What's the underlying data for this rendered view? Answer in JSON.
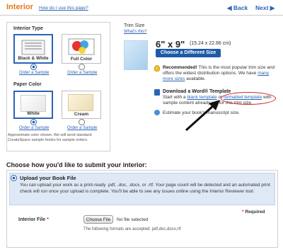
{
  "header": {
    "title": "Interior",
    "how_link": "How do I use this page?",
    "back_label": "◀ Back",
    "next_label": "Next ▶"
  },
  "interior_type": {
    "label": "Interior Type",
    "options": [
      {
        "label": "Black & White",
        "sample": "Order a Sample",
        "selected": true
      },
      {
        "label": "Full Color",
        "sample": "Order a Sample",
        "selected": false
      }
    ]
  },
  "paper_color": {
    "label": "Paper Color",
    "options": [
      {
        "label": "White",
        "sample": "Order a Sample",
        "selected": true
      },
      {
        "label": "Cream",
        "sample": "Order a Sample",
        "selected": false
      }
    ],
    "note": "Approximate color shown. We will send standard CreateSpace sample books for sample orders."
  },
  "trim": {
    "label": "Trim Size",
    "whats_this": "What's this?",
    "size": "6\" x 9\"",
    "size_cm": "(15.24 x 22.86 cm)",
    "choose_button": "Choose a Different Size",
    "recommended_title": "Recommended!",
    "recommended_text": "This is the most popular trim size and offers the widest distribution options. We have",
    "recommended_link": "many more sizes",
    "recommended_tail": "available.",
    "download_title": "Download a Word® Template",
    "download_prefix": "Start with a",
    "blank_template": "blank template",
    "download_or": "or",
    "formatted_template": "formatted template",
    "download_suffix": "with sample content already set for this trim size.",
    "estimate_text": "Estimate your book's manuscript size."
  },
  "submit": {
    "title": "Choose how you'd like to submit your interior:",
    "upload_title": "Upload your Book File",
    "upload_desc": "You can upload your work as a print-ready .pdf, .doc, .docx, or .rtf. Your page count will be detected and an automated print check will run once your upload is complete. You'll be able to see any issues online using the Interior Reviewer tool.",
    "required": "Required",
    "file_label": "Interior File",
    "choose_file": "Choose File",
    "no_file": "No file selected",
    "formats": "The following formats are accepted: pdf,doc,docx,rtf"
  },
  "colors": {
    "accent": "#2a64b5",
    "title_orange": "#e07b1a",
    "highlight_red": "#d8282a",
    "upload_bg": "#dfe9f6"
  }
}
